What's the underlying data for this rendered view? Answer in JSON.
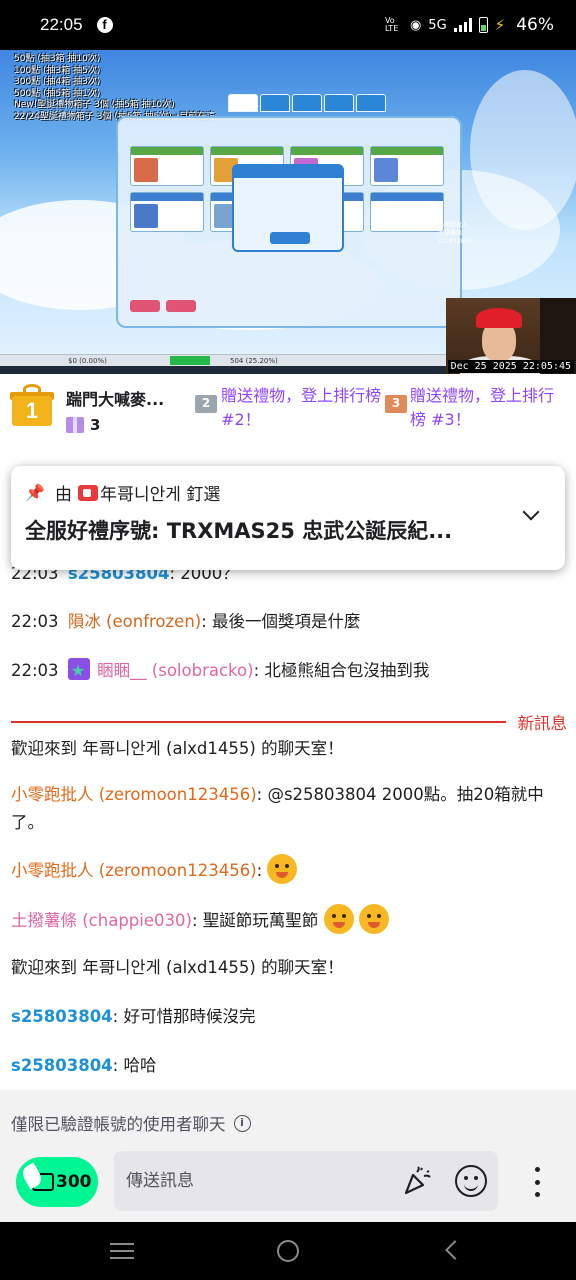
{
  "status_bar": {
    "time": "22:05",
    "network_label": "Vo LTE",
    "network_type": "5G",
    "battery": "46%",
    "notification_icon": "facebook-icon"
  },
  "video": {
    "overlay_lines": [
      "50點 (抽3箱 抽10次)",
      "100點 (抽3箱 抽5次)",
      "300點 (抽4箱 抽3次)",
      "500點 (抽5箱 抽1次)",
      "New!聖誕禮物箱子 3個 (抽5箱 抽10次)",
      "22/24聖誕禮物箱子 3個 (抽5箱 抽5次)→目前在這"
    ],
    "mini_chat": [
      "小零跑批人",
      "土撥薯條",
      "s25803804"
    ],
    "status_values": [
      "$0 (0.00%)",
      "504 (25.20%)"
    ],
    "progress_fraction": 0.25,
    "timestamp": "Dec 25 2025 22:05:45"
  },
  "leaderboard": {
    "first": {
      "rank": "1",
      "name": "踹門大喊麥...",
      "count": "3"
    },
    "second": {
      "rank": "2",
      "text": "贈送禮物，登上排行榜 #2！"
    },
    "third": {
      "rank": "3",
      "text": "贈送禮物，登上排行榜 #3！"
    }
  },
  "pinned": {
    "by_prefix": "由",
    "by_name": "年哥니안게 釘選",
    "message": "全服好禮序號: TRXMAS25 忠武公誕辰紀..."
  },
  "chat": {
    "messages": [
      {
        "time": "22:03",
        "user": "s25803804",
        "text": ": 2000？"
      },
      {
        "time": "22:03",
        "user": "隕冰 (eonfrozen)",
        "text": ": 最後一個獎項是什麼"
      },
      {
        "time": "22:03",
        "user": "睏睏__ (solobracko)",
        "text": ": 北極熊組合包沒抽到我"
      },
      {
        "system": "歡迎來到 年哥니안게 (alxd1455) 的聊天室！"
      },
      {
        "user": "小零跑批人 (zeromoon123456)",
        "text": ": @s25803804 2000點。抽20箱就中了。"
      },
      {
        "user": "小零跑批人 (zeromoon123456)",
        "text": ":"
      },
      {
        "user": "土撥薯條 (chappie030)",
        "text": ": 聖誕節玩萬聖節"
      },
      {
        "system": "歡迎來到 年哥니안게 (alxd1455) 的聊天室！"
      },
      {
        "user": "s25803804",
        "text": ": 好可惜那時候沒完"
      },
      {
        "user": "s25803804",
        "text": ": 哈哈"
      }
    ],
    "divider_label": "新訊息"
  },
  "notice": {
    "text": "僅限已驗證帳號的使用者聊天"
  },
  "input": {
    "points": "300",
    "placeholder": "傳送訊息"
  },
  "colors": {
    "accent_purple": "#9146ff",
    "points_green": "#00f593",
    "divider_red": "#e0332f",
    "user_blue": "#1e90d6"
  }
}
